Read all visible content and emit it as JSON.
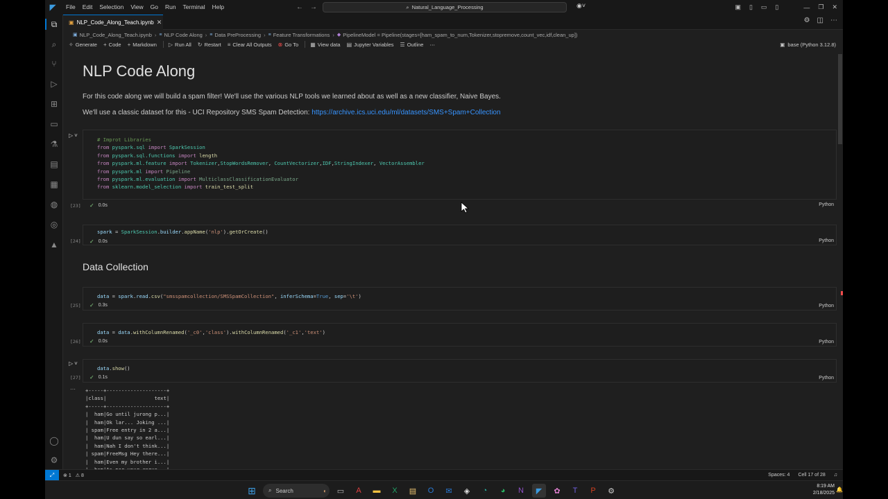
{
  "titlebar": {
    "menu": [
      "File",
      "Edit",
      "Selection",
      "View",
      "Go",
      "Run",
      "Terminal",
      "Help"
    ],
    "search": "Natural_Language_Processing"
  },
  "tab": {
    "label": "NLP_Code_Along_Teach.ipynb"
  },
  "breadcrumb": {
    "file": "NLP_Code_Along_Teach.ipynb",
    "h1": "NLP Code Along",
    "h2": "Data PreProcessing",
    "h3": "Feature Transformations",
    "symbol": "PipelineModel = Pipeline(stages=[ham_spam_to_num,Tokenizer,stopremove,count_vec,idf,clean_up])"
  },
  "toolbar": {
    "generate": "Generate",
    "code": "Code",
    "markdown": "Markdown",
    "run_all": "Run All",
    "restart": "Restart",
    "clear_outputs": "Clear All Outputs",
    "go_to": "Go To",
    "view_data": "View data",
    "jupyter_variables": "Jupyter Variables",
    "outline": "Outline",
    "kernel": "base (Python 3.12.8)"
  },
  "markdown": {
    "title": "NLP Code Along",
    "p1": "For this code along we will build a spam filter! We'll use the various NLP tools we learned about as well as a new classifier, Naive Bayes.",
    "p2_prefix": "We'll use a classic dataset for this - UCI Repository SMS Spam Detection: ",
    "p2_link": "https://archive.ics.uci.edu/ml/datasets/SMS+Spam+Collection",
    "section": "Data Collection"
  },
  "cells": [
    {
      "exec": "[23]",
      "time": "0.0s",
      "lang": "Python"
    },
    {
      "exec": "[24]",
      "time": "0.0s",
      "lang": "Python"
    },
    {
      "exec": "[25]",
      "time": "0.3s",
      "lang": "Python"
    },
    {
      "exec": "[26]",
      "time": "0.0s",
      "lang": "Python"
    },
    {
      "exec": "[27]",
      "time": "0.1s",
      "lang": "Python"
    }
  ],
  "statusbar": {
    "errors": "1",
    "warnings": "8",
    "spaces": "Spaces: 4",
    "cell": "Cell 17 of 28"
  },
  "taskbar": {
    "search": "Search",
    "time": "8:19 AM",
    "date": "2/18/2025"
  }
}
